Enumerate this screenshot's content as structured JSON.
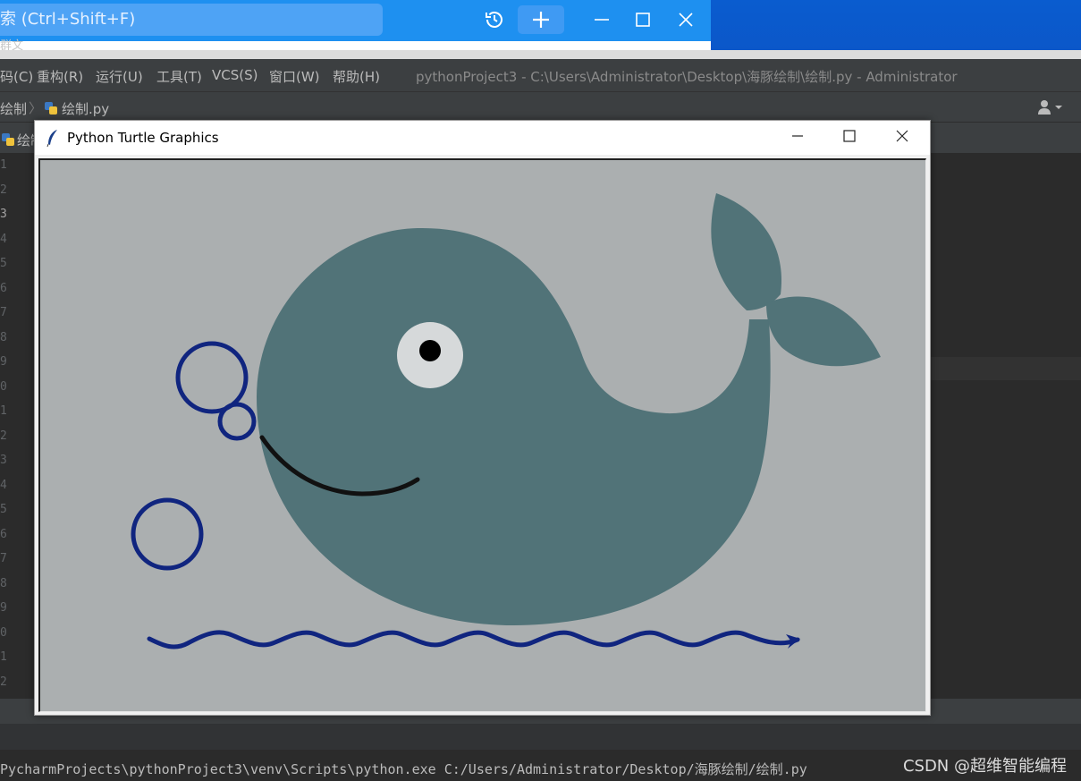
{
  "browser": {
    "search_placeholder": "索 (Ctrl+Shift+F)",
    "stray_text": "群文"
  },
  "ide": {
    "menu": [
      "码(C)",
      "重构(R)",
      "运行(U)",
      "工具(T)",
      "VCS(S)",
      "窗口(W)",
      "帮助(H)"
    ],
    "window_title": "pythonProject3 - C:\\Users\\Administrator\\Desktop\\海豚绘制\\绘制.py - Administrator",
    "breadcrumb": [
      "绘制",
      "绘制.py"
    ],
    "open_tab": "绘制",
    "line_numbers": [
      "1",
      "2",
      "3",
      "4",
      "5",
      "6",
      "7",
      "8",
      "9",
      "0",
      "1",
      "2",
      "3",
      "4",
      "5",
      "6",
      "7",
      "8",
      "9",
      "0",
      "1",
      "2"
    ],
    "console_text": "PycharmProjects\\pythonProject3\\venv\\Scripts\\python.exe C:/Users/Administrator/Desktop/海豚绘制/绘制.py",
    "watermark": "CSDN @超维智能编程"
  },
  "turtle_window": {
    "title": "Python Turtle Graphics",
    "colors": {
      "canvas_bg": "#abafb0",
      "whale": "#517378",
      "bubbles": "#10257f",
      "smile": "#111111",
      "eye_white": "#d6d9da",
      "pupil": "#000000"
    }
  }
}
